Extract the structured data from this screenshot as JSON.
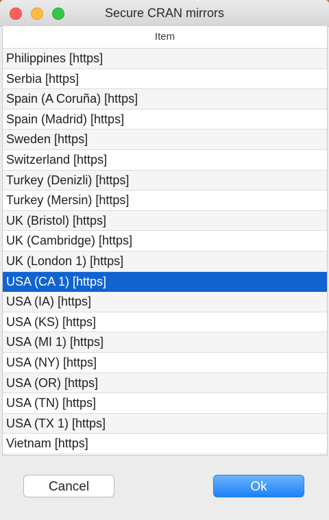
{
  "window": {
    "title": "Secure CRAN mirrors"
  },
  "list": {
    "header": "Item",
    "selected_index": 11,
    "items": [
      "Philippines [https]",
      "Serbia [https]",
      "Spain (A Coruña) [https]",
      "Spain (Madrid) [https]",
      "Sweden [https]",
      "Switzerland [https]",
      "Turkey (Denizli) [https]",
      "Turkey (Mersin) [https]",
      "UK (Bristol) [https]",
      "UK (Cambridge) [https]",
      "UK (London 1) [https]",
      "USA (CA 1) [https]",
      "USA (IA) [https]",
      "USA (KS) [https]",
      "USA (MI 1) [https]",
      "USA (NY) [https]",
      "USA (OR) [https]",
      "USA (TN) [https]",
      "USA (TX 1) [https]",
      "Vietnam [https]"
    ]
  },
  "buttons": {
    "cancel_label": "Cancel",
    "ok_label": "Ok"
  },
  "colors": {
    "selection": "#1063d1",
    "ok_button": "#1a82f7",
    "close": "#fc605c",
    "minimize": "#fdbc40",
    "zoom": "#34c84a"
  }
}
